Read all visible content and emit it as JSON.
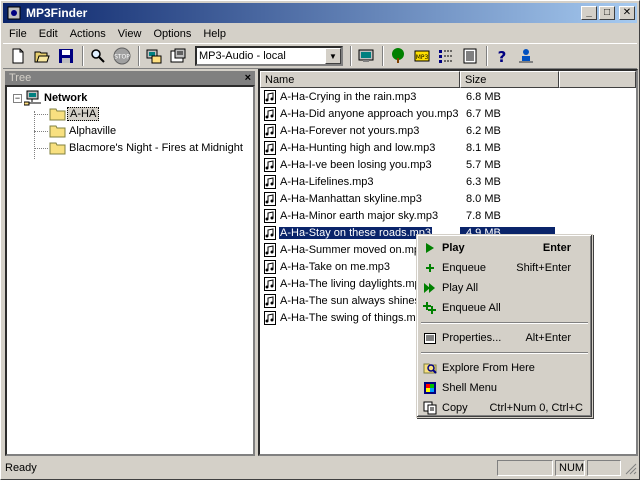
{
  "window": {
    "title": "MP3Finder",
    "min": "_",
    "max": "□",
    "close": "✕"
  },
  "menu": [
    "File",
    "Edit",
    "Actions",
    "View",
    "Options",
    "Help"
  ],
  "toolbar": {
    "combo_value": "MP3-Audio - local",
    "buttons": [
      "new-icon",
      "open-icon",
      "save-icon",
      "search-icon",
      "stop-icon",
      "computer-icon",
      "properties-icon",
      "tree-icon",
      "mp3-icon",
      "details-icon",
      "list-icon",
      "help-icon",
      "user-icon"
    ]
  },
  "tree": {
    "header": "Tree",
    "close": "×",
    "nodes": [
      {
        "label": "Network",
        "expander": "−",
        "selected": false
      },
      {
        "label": "A-HA",
        "selected": true
      },
      {
        "label": "Alphaville",
        "selected": false
      },
      {
        "label": "Blacmore's Night - Fires at Midnight",
        "selected": false
      }
    ]
  },
  "list": {
    "columns": [
      "Name",
      "Size"
    ],
    "rows": [
      {
        "name": "A-Ha-Crying in the rain.mp3",
        "size": "6.8 MB"
      },
      {
        "name": "A-Ha-Did anyone approach you.mp3",
        "size": "6.7 MB"
      },
      {
        "name": "A-Ha-Forever not yours.mp3",
        "size": "6.2 MB"
      },
      {
        "name": "A-Ha-Hunting high and low.mp3",
        "size": "8.1 MB"
      },
      {
        "name": "A-Ha-I-ve been losing you.mp3",
        "size": "5.7 MB"
      },
      {
        "name": "A-Ha-Lifelines.mp3",
        "size": "6.3 MB"
      },
      {
        "name": "A-Ha-Manhattan skyline.mp3",
        "size": "8.0 MB"
      },
      {
        "name": "A-Ha-Minor earth major sky.mp3",
        "size": "7.8 MB"
      },
      {
        "name": "A-Ha-Stay on these roads.mp3",
        "size": "4.9 MB",
        "selected": true
      },
      {
        "name": "A-Ha-Summer moved on.mp3",
        "size": ""
      },
      {
        "name": "A-Ha-Take on me.mp3",
        "size": ""
      },
      {
        "name": "A-Ha-The living daylights.mp3",
        "size": ""
      },
      {
        "name": "A-Ha-The sun always shines",
        "size": ""
      },
      {
        "name": "A-Ha-The swing of things.mp3",
        "size": ""
      }
    ]
  },
  "context_menu": {
    "play": {
      "label": "Play",
      "key": "Enter"
    },
    "enqueue": {
      "label": "Enqueue",
      "key": "Shift+Enter"
    },
    "play_all": {
      "label": "Play All"
    },
    "enqueue_all": {
      "label": "Enqueue All"
    },
    "properties": {
      "label": "Properties...",
      "key": "Alt+Enter"
    },
    "explore": {
      "label": "Explore From Here"
    },
    "shell": {
      "label": "Shell Menu"
    },
    "copy": {
      "label": "Copy",
      "key": "Ctrl+Num 0, Ctrl+C"
    }
  },
  "status": {
    "text": "Ready",
    "num": "NUM"
  }
}
